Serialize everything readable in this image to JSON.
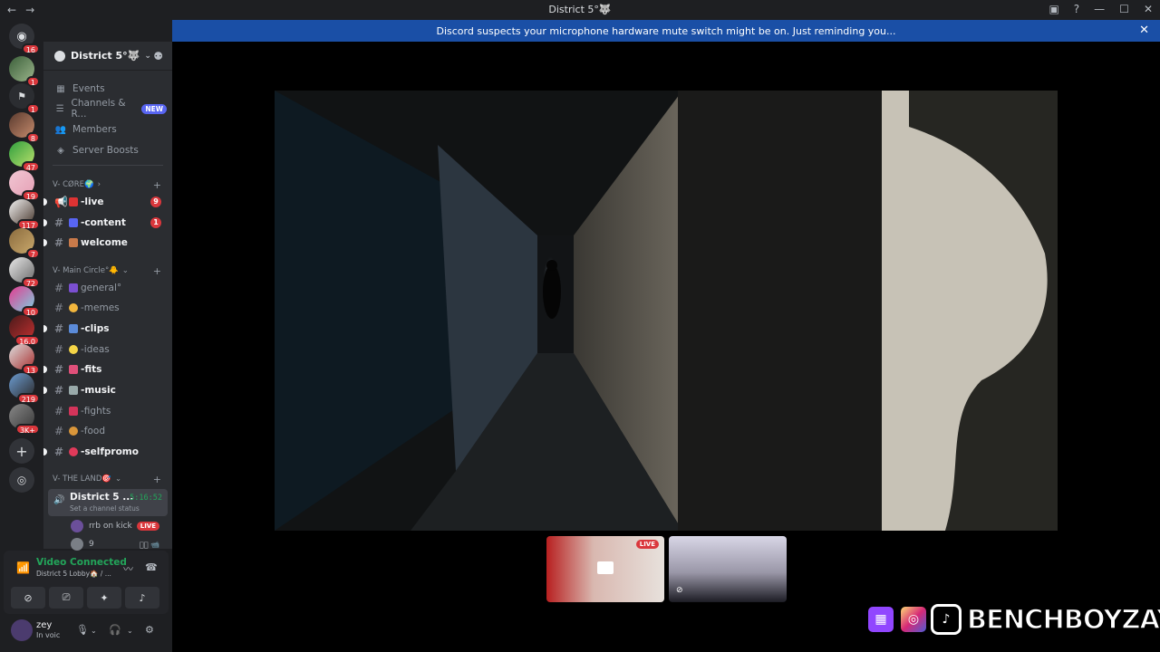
{
  "window": {
    "title": "District 5°🐺"
  },
  "notice": {
    "text": "Discord suspects your microphone hardware mute switch might be on. Just reminding you..."
  },
  "rail": {
    "home_badge": "16",
    "servers": [
      {
        "badge": "1"
      },
      {
        "badge": "1"
      },
      {
        "badge": "8"
      },
      {
        "badge": "47"
      },
      {
        "badge": "19"
      },
      {
        "badge": "117"
      },
      {
        "badge": "7"
      },
      {
        "badge": "72"
      },
      {
        "badge": "10"
      },
      {
        "badge": "16.0"
      },
      {
        "badge": "13"
      },
      {
        "badge": "219"
      },
      {
        "badge": "3K+"
      }
    ]
  },
  "guild": {
    "name": "District 5°🐺"
  },
  "nav": {
    "events": "Events",
    "channels_roles": "Channels & R...",
    "new_tag": "NEW",
    "members": "Members",
    "server_boosts": "Server Boosts"
  },
  "categories": {
    "core": "V- CØRE🌍",
    "main_circle": "V- Main Circle°🐥",
    "the_land": "V- THE LAND🎯"
  },
  "channels": {
    "live": {
      "label": "-live",
      "badge": "9"
    },
    "content": {
      "label": "-content",
      "badge": "1"
    },
    "welcome": {
      "label": "welcome"
    },
    "general": {
      "label": "general°"
    },
    "memes": {
      "label": "-memes"
    },
    "clips": {
      "label": "-clips"
    },
    "ideas": {
      "label": "-ideas"
    },
    "fits": {
      "label": "-fits"
    },
    "music": {
      "label": "-music"
    },
    "fights": {
      "label": "-fights"
    },
    "food": {
      "label": "-food"
    },
    "selfpromo": {
      "label": "-selfpromo"
    }
  },
  "voice_channel": {
    "name": "District 5 ...",
    "time": "5:16:52",
    "status": "Set a channel status"
  },
  "voice_users": [
    {
      "name": "rrb on kick",
      "live": "LIVE"
    },
    {
      "name": "9"
    }
  ],
  "voice_panel": {
    "title": "Video Connected",
    "sub": "District 5 Lobby🏠 / ..."
  },
  "user": {
    "name": "zey",
    "status": "In voic"
  },
  "stage": {
    "thumb_live": "LIVE"
  },
  "overlay": {
    "brand": "BENCHBOYZAY"
  },
  "colors": {
    "accent": "#5865f2",
    "danger": "#da373c",
    "online": "#23a55a",
    "notice": "#1a4fa6"
  }
}
